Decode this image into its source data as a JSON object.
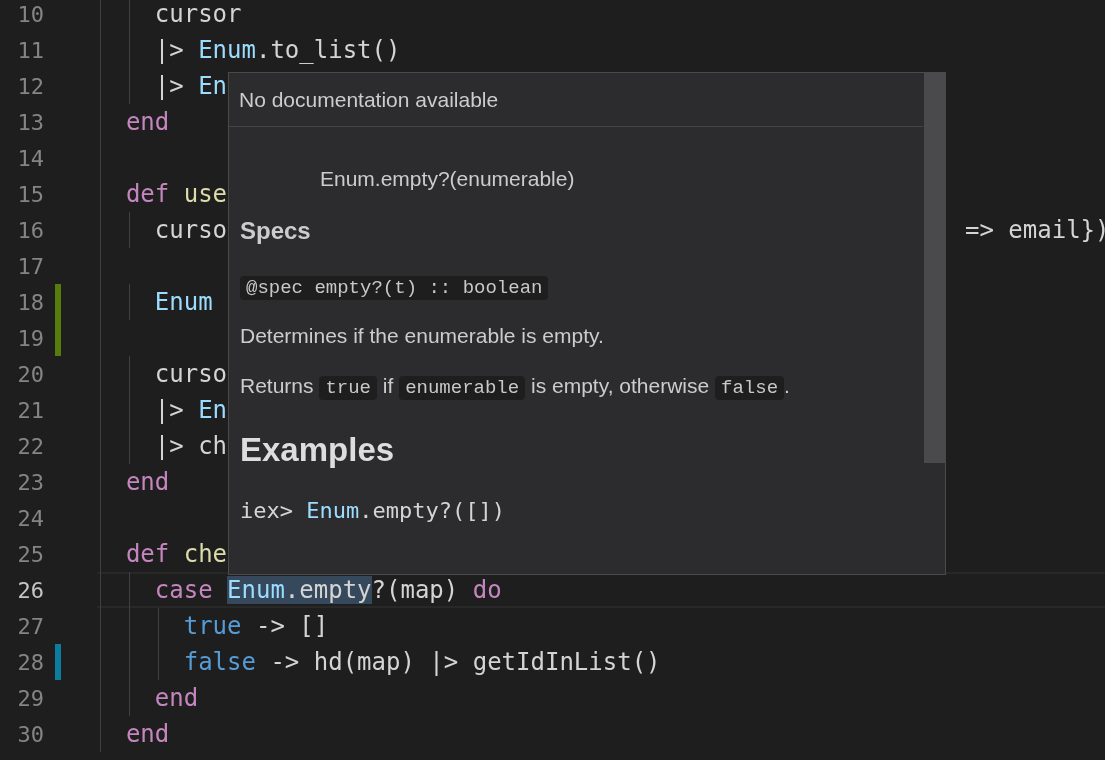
{
  "editor": {
    "lines": [
      {
        "number": "10",
        "current": false,
        "added": false,
        "modified": false,
        "tokens": [
          {
            "text": "    cursor",
            "kind": "plain",
            "selected": false
          }
        ]
      },
      {
        "number": "11",
        "current": false,
        "added": false,
        "modified": false,
        "tokens": [
          {
            "text": "    |> ",
            "kind": "plain",
            "selected": false
          },
          {
            "text": "Enum",
            "kind": "module",
            "selected": false
          },
          {
            "text": ".to_list()",
            "kind": "plain",
            "selected": false
          }
        ]
      },
      {
        "number": "12",
        "current": false,
        "added": false,
        "modified": false,
        "tokens": [
          {
            "text": "    |> ",
            "kind": "plain",
            "selected": false
          },
          {
            "text": "En",
            "kind": "module",
            "selected": false
          }
        ]
      },
      {
        "number": "13",
        "current": false,
        "added": false,
        "modified": false,
        "tokens": [
          {
            "text": "  end",
            "kind": "keyword",
            "selected": false
          }
        ]
      },
      {
        "number": "14",
        "current": false,
        "added": false,
        "modified": false
      },
      {
        "number": "15",
        "current": false,
        "added": false,
        "modified": false,
        "tokens": [
          {
            "text": "  def",
            "kind": "keyword",
            "selected": false
          },
          {
            "text": " use",
            "kind": "function",
            "selected": false
          }
        ]
      },
      {
        "number": "16",
        "current": false,
        "added": false,
        "modified": false,
        "tokens": [
          {
            "text": "    curso",
            "kind": "plain",
            "selected": false
          }
        ],
        "tail": [
          {
            "text": "=> email})",
            "kind": "plain",
            "selected": false
          }
        ]
      },
      {
        "number": "17",
        "current": false,
        "added": false,
        "modified": false
      },
      {
        "number": "18",
        "current": false,
        "added": true,
        "modified": false,
        "tokens": [
          {
            "text": "    Enum",
            "kind": "module",
            "selected": false
          }
        ]
      },
      {
        "number": "19",
        "current": false,
        "added": true,
        "modified": false
      },
      {
        "number": "20",
        "current": false,
        "added": false,
        "modified": false,
        "tokens": [
          {
            "text": "    curso",
            "kind": "plain",
            "selected": false
          }
        ]
      },
      {
        "number": "21",
        "current": false,
        "added": false,
        "modified": false,
        "tokens": [
          {
            "text": "    |> ",
            "kind": "plain",
            "selected": false
          },
          {
            "text": "En",
            "kind": "module",
            "selected": false
          }
        ]
      },
      {
        "number": "22",
        "current": false,
        "added": false,
        "modified": false,
        "tokens": [
          {
            "text": "    |> ch",
            "kind": "plain",
            "selected": false
          }
        ]
      },
      {
        "number": "23",
        "current": false,
        "added": false,
        "modified": false,
        "tokens": [
          {
            "text": "  end",
            "kind": "keyword",
            "selected": false
          }
        ]
      },
      {
        "number": "24",
        "current": false,
        "added": false,
        "modified": false
      },
      {
        "number": "25",
        "current": false,
        "added": false,
        "modified": false,
        "tokens": [
          {
            "text": "  def",
            "kind": "keyword",
            "selected": false
          },
          {
            "text": " che",
            "kind": "function",
            "selected": false
          }
        ]
      },
      {
        "number": "26",
        "current": true,
        "added": false,
        "modified": false,
        "tokens": [
          {
            "text": "    case ",
            "kind": "keyword",
            "selected": false
          },
          {
            "text": "Enum",
            "kind": "module",
            "selected": true
          },
          {
            "text": ".empty",
            "kind": "plain",
            "selected": true
          },
          {
            "text": "?(map) ",
            "kind": "plain",
            "selected": false
          },
          {
            "text": "do",
            "kind": "keyword",
            "selected": false
          }
        ]
      },
      {
        "number": "27",
        "current": false,
        "added": false,
        "modified": false,
        "tokens": [
          {
            "text": "      true",
            "kind": "constant",
            "selected": false
          },
          {
            "text": " -> []",
            "kind": "plain",
            "selected": false
          }
        ]
      },
      {
        "number": "28",
        "current": false,
        "added": false,
        "modified": true,
        "tokens": [
          {
            "text": "      false",
            "kind": "constant",
            "selected": false
          },
          {
            "text": " -> hd(map) |> getIdInList()",
            "kind": "plain",
            "selected": false
          }
        ]
      },
      {
        "number": "29",
        "current": false,
        "added": false,
        "modified": false,
        "tokens": [
          {
            "text": "    end",
            "kind": "keyword",
            "selected": false
          }
        ]
      },
      {
        "number": "30",
        "current": false,
        "added": false,
        "modified": false,
        "tokens": [
          {
            "text": "  end",
            "kind": "keyword",
            "selected": false
          }
        ]
      }
    ]
  },
  "hover": {
    "header": "No documentation available",
    "signature": "Enum.empty?(enumerable)",
    "specs_heading": "Specs",
    "spec": "@spec empty?(t) :: boolean",
    "description": "Determines if the enumerable is empty.",
    "returns": [
      {
        "text": "Returns ",
        "code": false
      },
      {
        "text": "true",
        "code": true
      },
      {
        "text": " if ",
        "code": false
      },
      {
        "text": "enumerable",
        "code": true
      },
      {
        "text": " is empty, otherwise ",
        "code": false
      },
      {
        "text": "false",
        "code": true
      },
      {
        "text": ".",
        "code": false
      }
    ],
    "examples_heading": "Examples",
    "example": [
      {
        "text": "iex> ",
        "kind": "plain"
      },
      {
        "text": "Enum",
        "kind": "module"
      },
      {
        "text": ".empty?([])",
        "kind": "plain"
      }
    ]
  }
}
